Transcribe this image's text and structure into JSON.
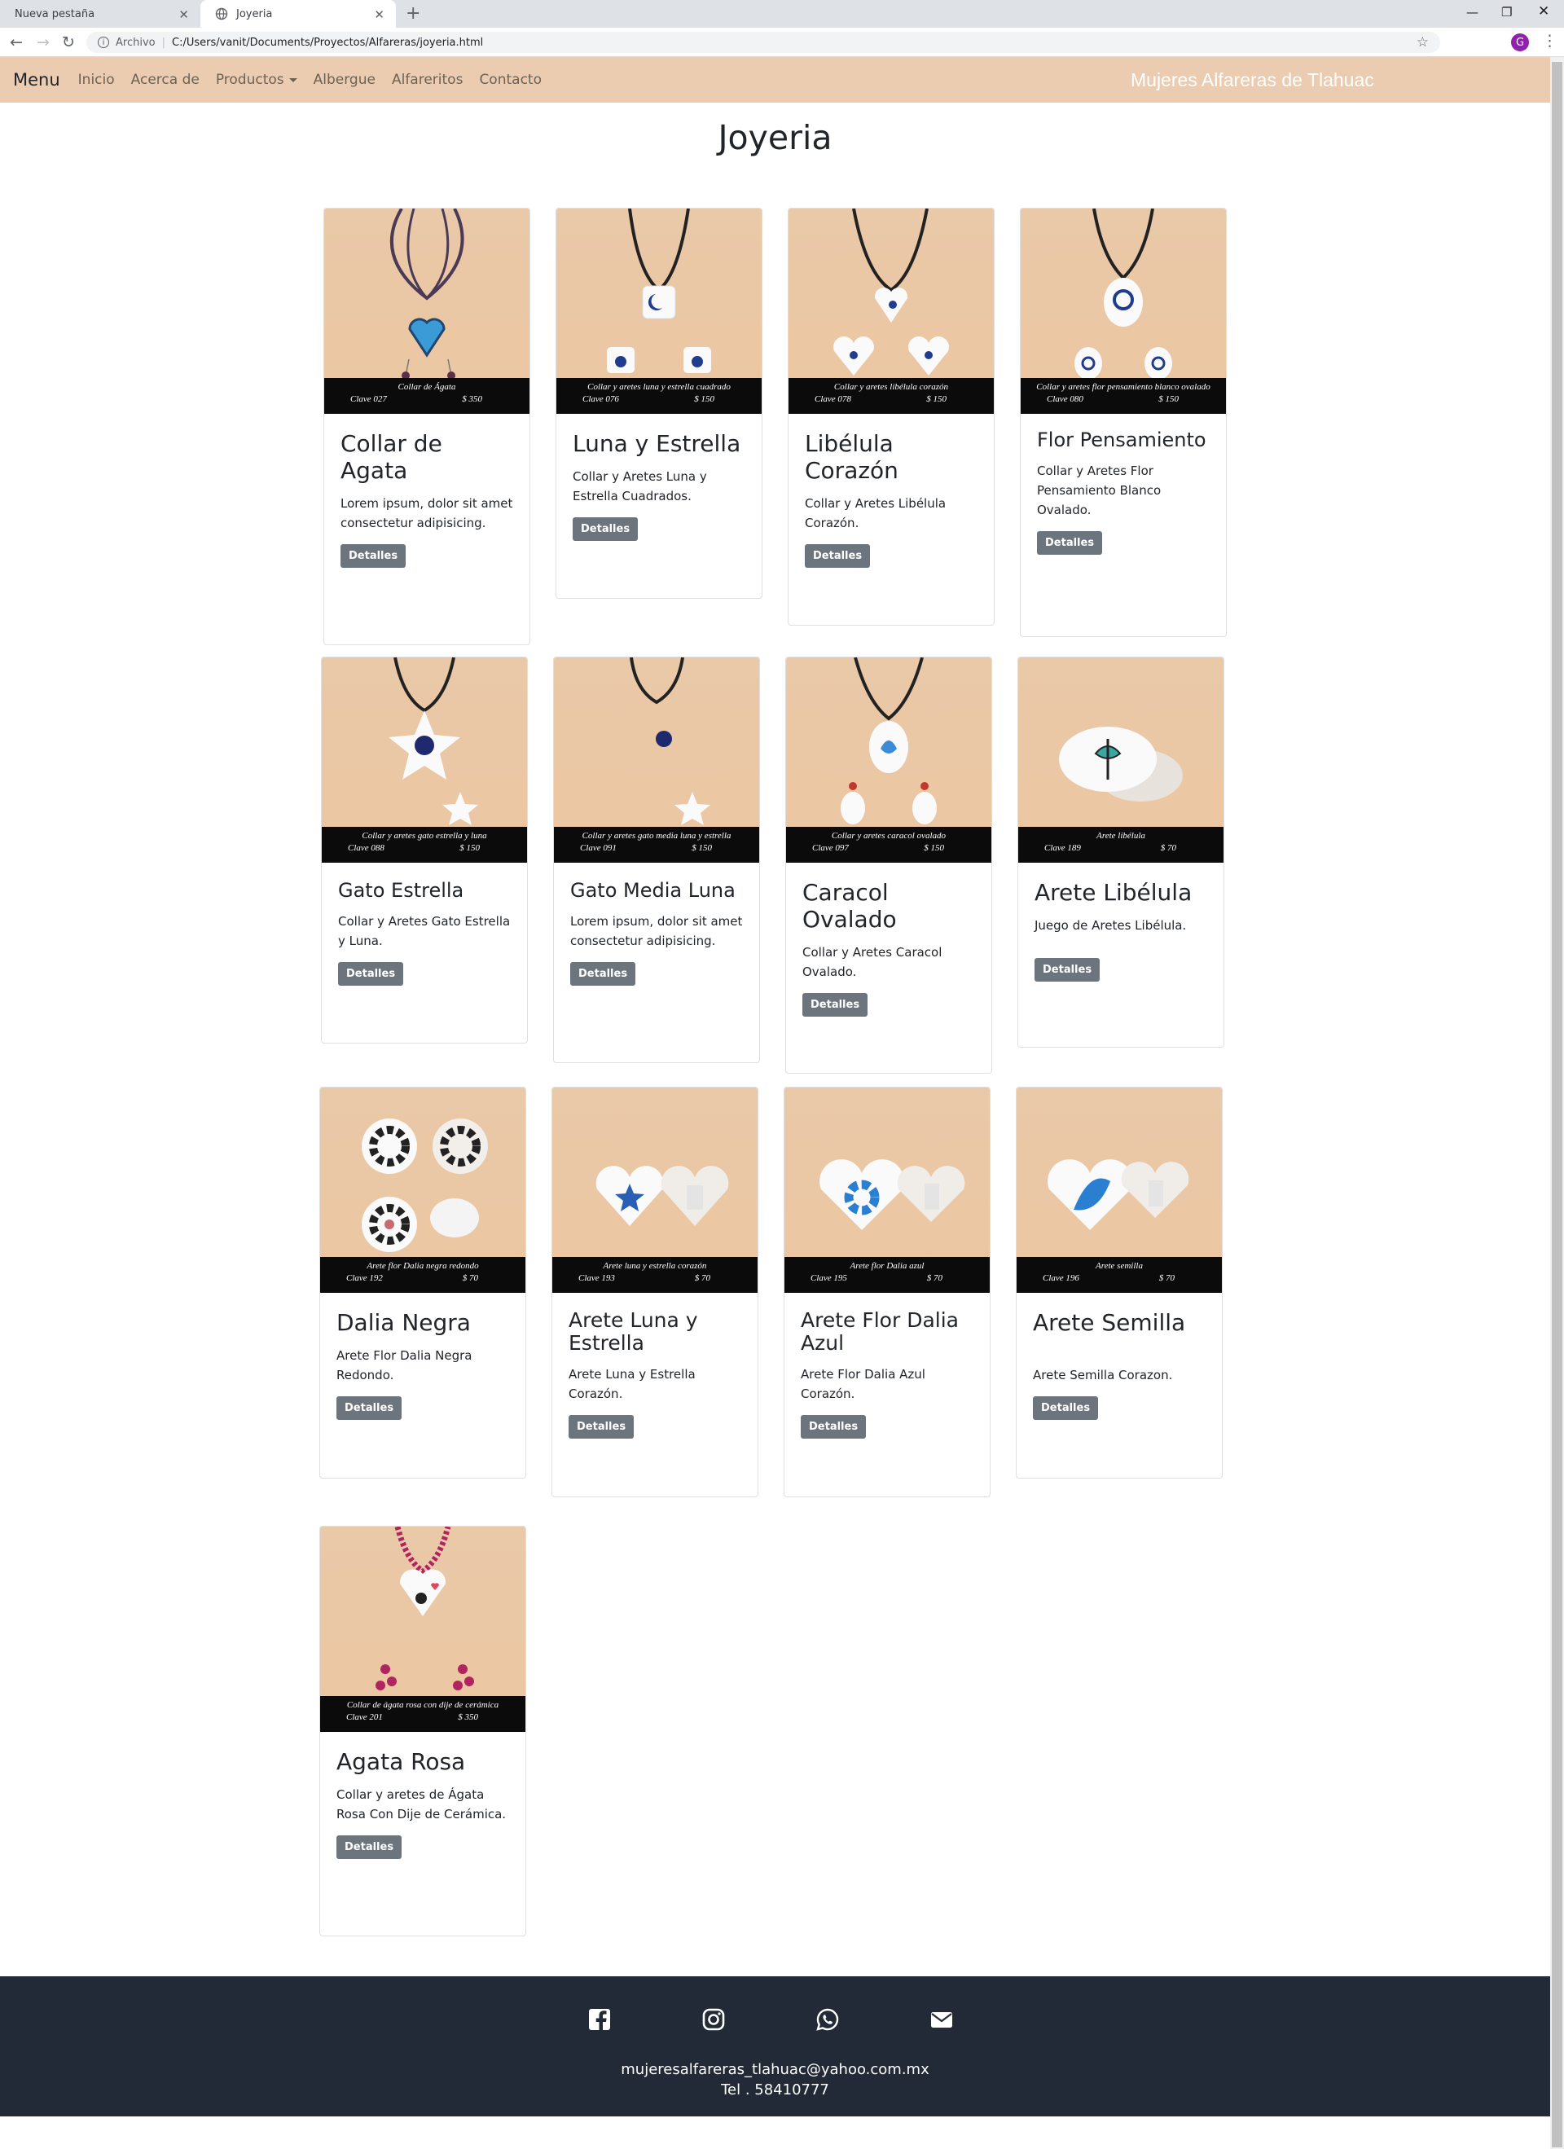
{
  "browser": {
    "tabs": [
      {
        "label": "Nueva pestaña"
      },
      {
        "label": "Joyeria"
      }
    ],
    "address": {
      "scheme": "Archivo",
      "url": "C:/Users/vanit/Documents/Proyectos/Alfareras/joyeria.html"
    },
    "profile_initial": "G"
  },
  "navbar": {
    "menu_label": "Menu",
    "links": [
      "Inicio",
      "Acerca de",
      "Productos",
      "Albergue",
      "Alfareritos",
      "Contacto"
    ],
    "brand": "Mujeres Alfareras de Tlahuac",
    "background": "#ecccb0"
  },
  "page": {
    "title": "Joyeria",
    "products": [
      {
        "title": "Collar de Agata",
        "text": "Lorem ipsum, dolor sit amet consectetur adipisicing.",
        "button": "Detalles",
        "band_desc": "Collar de Ágata",
        "band_clave": "Clave 027",
        "band_price": "$ 350"
      },
      {
        "title": "Luna y Estrella",
        "text": "Collar y Aretes Luna y Estrella Cuadrados.",
        "button": "Detalles",
        "band_desc": "Collar y aretes luna y estrella cuadrado",
        "band_clave": "Clave 076",
        "band_price": "$ 150"
      },
      {
        "title": "Libélula Corazón",
        "text": "Collar y Aretes Libélula Corazón.",
        "button": "Detalles",
        "band_desc": "Collar y aretes libélula corazón",
        "band_clave": "Clave 078",
        "band_price": "$ 150"
      },
      {
        "title": "Flor Pensamiento",
        "text": "Collar y Aretes Flor Pensamiento Blanco Ovalado.",
        "button": "Detalles",
        "band_desc": "Collar y aretes flor pensamiento blanco ovalado",
        "band_clave": "Clave 080",
        "band_price": "$ 150"
      },
      {
        "title": "Gato Estrella",
        "text": "Collar y Aretes Gato Estrella y Luna.",
        "button": "Detalles",
        "band_desc": "Collar y aretes gato estrella y luna",
        "band_clave": "Clave 088",
        "band_price": "$ 150"
      },
      {
        "title": "Gato Media Luna",
        "text": "Lorem ipsum, dolor sit amet consectetur adipisicing.",
        "button": "Detalles",
        "band_desc": "Collar y aretes gato media luna y estrella",
        "band_clave": "Clave 091",
        "band_price": "$ 150"
      },
      {
        "title": "Caracol Ovalado",
        "text": "Collar y Aretes Caracol Ovalado.",
        "button": "Detalles",
        "band_desc": "Collar y aretes caracol ovalado",
        "band_clave": "Clave 097",
        "band_price": "$ 150"
      },
      {
        "title": "Arete Libélula",
        "text": "Juego de Aretes Libélula.",
        "button": "Detalles",
        "band_desc": "Arete libélula",
        "band_clave": "Clave 189",
        "band_price": "$ 70"
      },
      {
        "title": "Dalia Negra",
        "text": "Arete Flor Dalia Negra Redondo.",
        "button": "Detalles",
        "band_desc": "Arete flor Dalia negra redondo",
        "band_clave": "Clave 192",
        "band_price": "$ 70"
      },
      {
        "title": "Arete Luna y Estrella",
        "text": "Arete Luna y Estrella Corazón.",
        "button": "Detalles",
        "band_desc": "Arete luna y estrella corazón",
        "band_clave": "Clave 193",
        "band_price": "$ 70"
      },
      {
        "title": "Arete Flor Dalia Azul",
        "text": "Arete Flor Dalia Azul Corazón.",
        "button": "Detalles",
        "band_desc": "Arete flor Dalia azul",
        "band_clave": "Clave 195",
        "band_price": "$ 70"
      },
      {
        "title": "Arete Semilla",
        "text": "Arete Semilla Corazon.",
        "button": "Detalles",
        "band_desc": "Arete semilla",
        "band_clave": "Clave 196",
        "band_price": "$ 70"
      },
      {
        "title": "Agata Rosa",
        "text": "Collar y aretes de Ágata Rosa Con Dije de Cerámica.",
        "button": "Detalles",
        "band_desc": "Collar de ágata rosa con dije de cerámica",
        "band_clave": "Clave 201",
        "band_price": "$ 350"
      }
    ]
  },
  "footer": {
    "icons": [
      "facebook-icon",
      "instagram-icon",
      "whatsapp-icon",
      "envelope-icon"
    ],
    "email": "mujeresalfareras_tlahuac@yahoo.com.mx",
    "tel": "Tel . 58410777",
    "background": "#212a36"
  }
}
